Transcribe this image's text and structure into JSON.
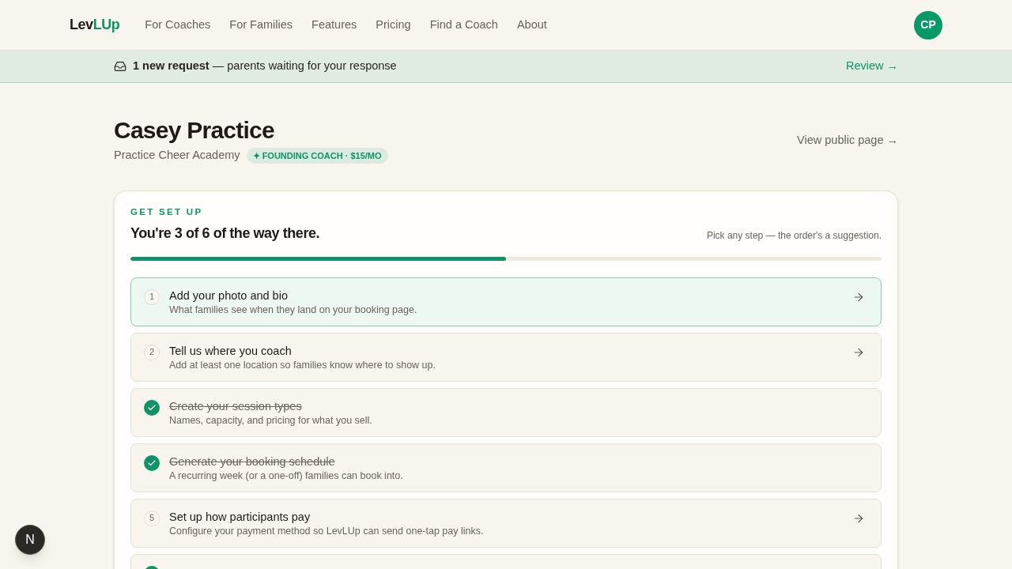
{
  "header": {
    "logo": {
      "part_1": "Lev",
      "part_2": "LUp"
    },
    "nav": [
      "For Coaches",
      "For Families",
      "Features",
      "Pricing",
      "Find a Coach",
      "About"
    ],
    "avatar": "CP"
  },
  "banner": {
    "message": "**1 new request** — parents waiting for your response",
    "action": "Review →"
  },
  "profile": {
    "name": "Casey Practice",
    "academy": "Practice Cheer Academy",
    "badge": "✦ FOUNDING COACH · $15/MO",
    "public_link": "View public page →"
  },
  "setup": {
    "eyebrow": "GET SET UP",
    "heading": "You're 3 of 6 of the way there.",
    "hint": "Pick any step — the order's a suggestion.",
    "progress": {
      "level": 0.5
    },
    "steps": [
      {
        "number": "1",
        "title": "Add your photo and bio",
        "description": "What families see when they land on your booking page.",
        "done": false,
        "selected": true
      },
      {
        "number": "2",
        "title": "Tell us where you coach",
        "description": "Add at least one location so families know where to show up.",
        "done": false,
        "selected": false
      },
      {
        "title": "Create your session types",
        "description": "Names, capacity, and pricing for what you sell.",
        "done": true,
        "selected": false
      },
      {
        "title": "Generate your booking schedule",
        "description": "A recurring week (or a one-off) families can book into.",
        "done": true,
        "selected": false
      },
      {
        "number": "5",
        "title": "Set up how participants pay",
        "description": "Configure your payment method so LevLUp can send one-tap pay links.",
        "done": false,
        "selected": false
      },
      {
        "done": true,
        "selected": false
      }
    ]
  },
  "dev_badge": "N"
}
